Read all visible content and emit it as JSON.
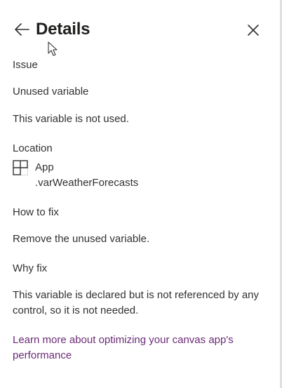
{
  "header": {
    "title": "Details",
    "back_icon": "arrow-left-icon",
    "close_icon": "close-icon"
  },
  "issue": {
    "label": "Issue",
    "name": "Unused variable",
    "description": "This variable is not used."
  },
  "location": {
    "label": "Location",
    "icon": "screen-layout-icon",
    "line1": "App",
    "line2": ".varWeatherForecasts"
  },
  "how_to_fix": {
    "label": "How to fix",
    "text": "Remove the unused variable."
  },
  "why_fix": {
    "label": "Why fix",
    "text": "This variable is declared but is not referenced by any control, so it is not needed."
  },
  "learn_more": {
    "text": "Learn more about optimizing your canvas app's performance"
  },
  "colors": {
    "link": "#6b2b78",
    "text": "#323130",
    "border": "#e1dfdd"
  }
}
